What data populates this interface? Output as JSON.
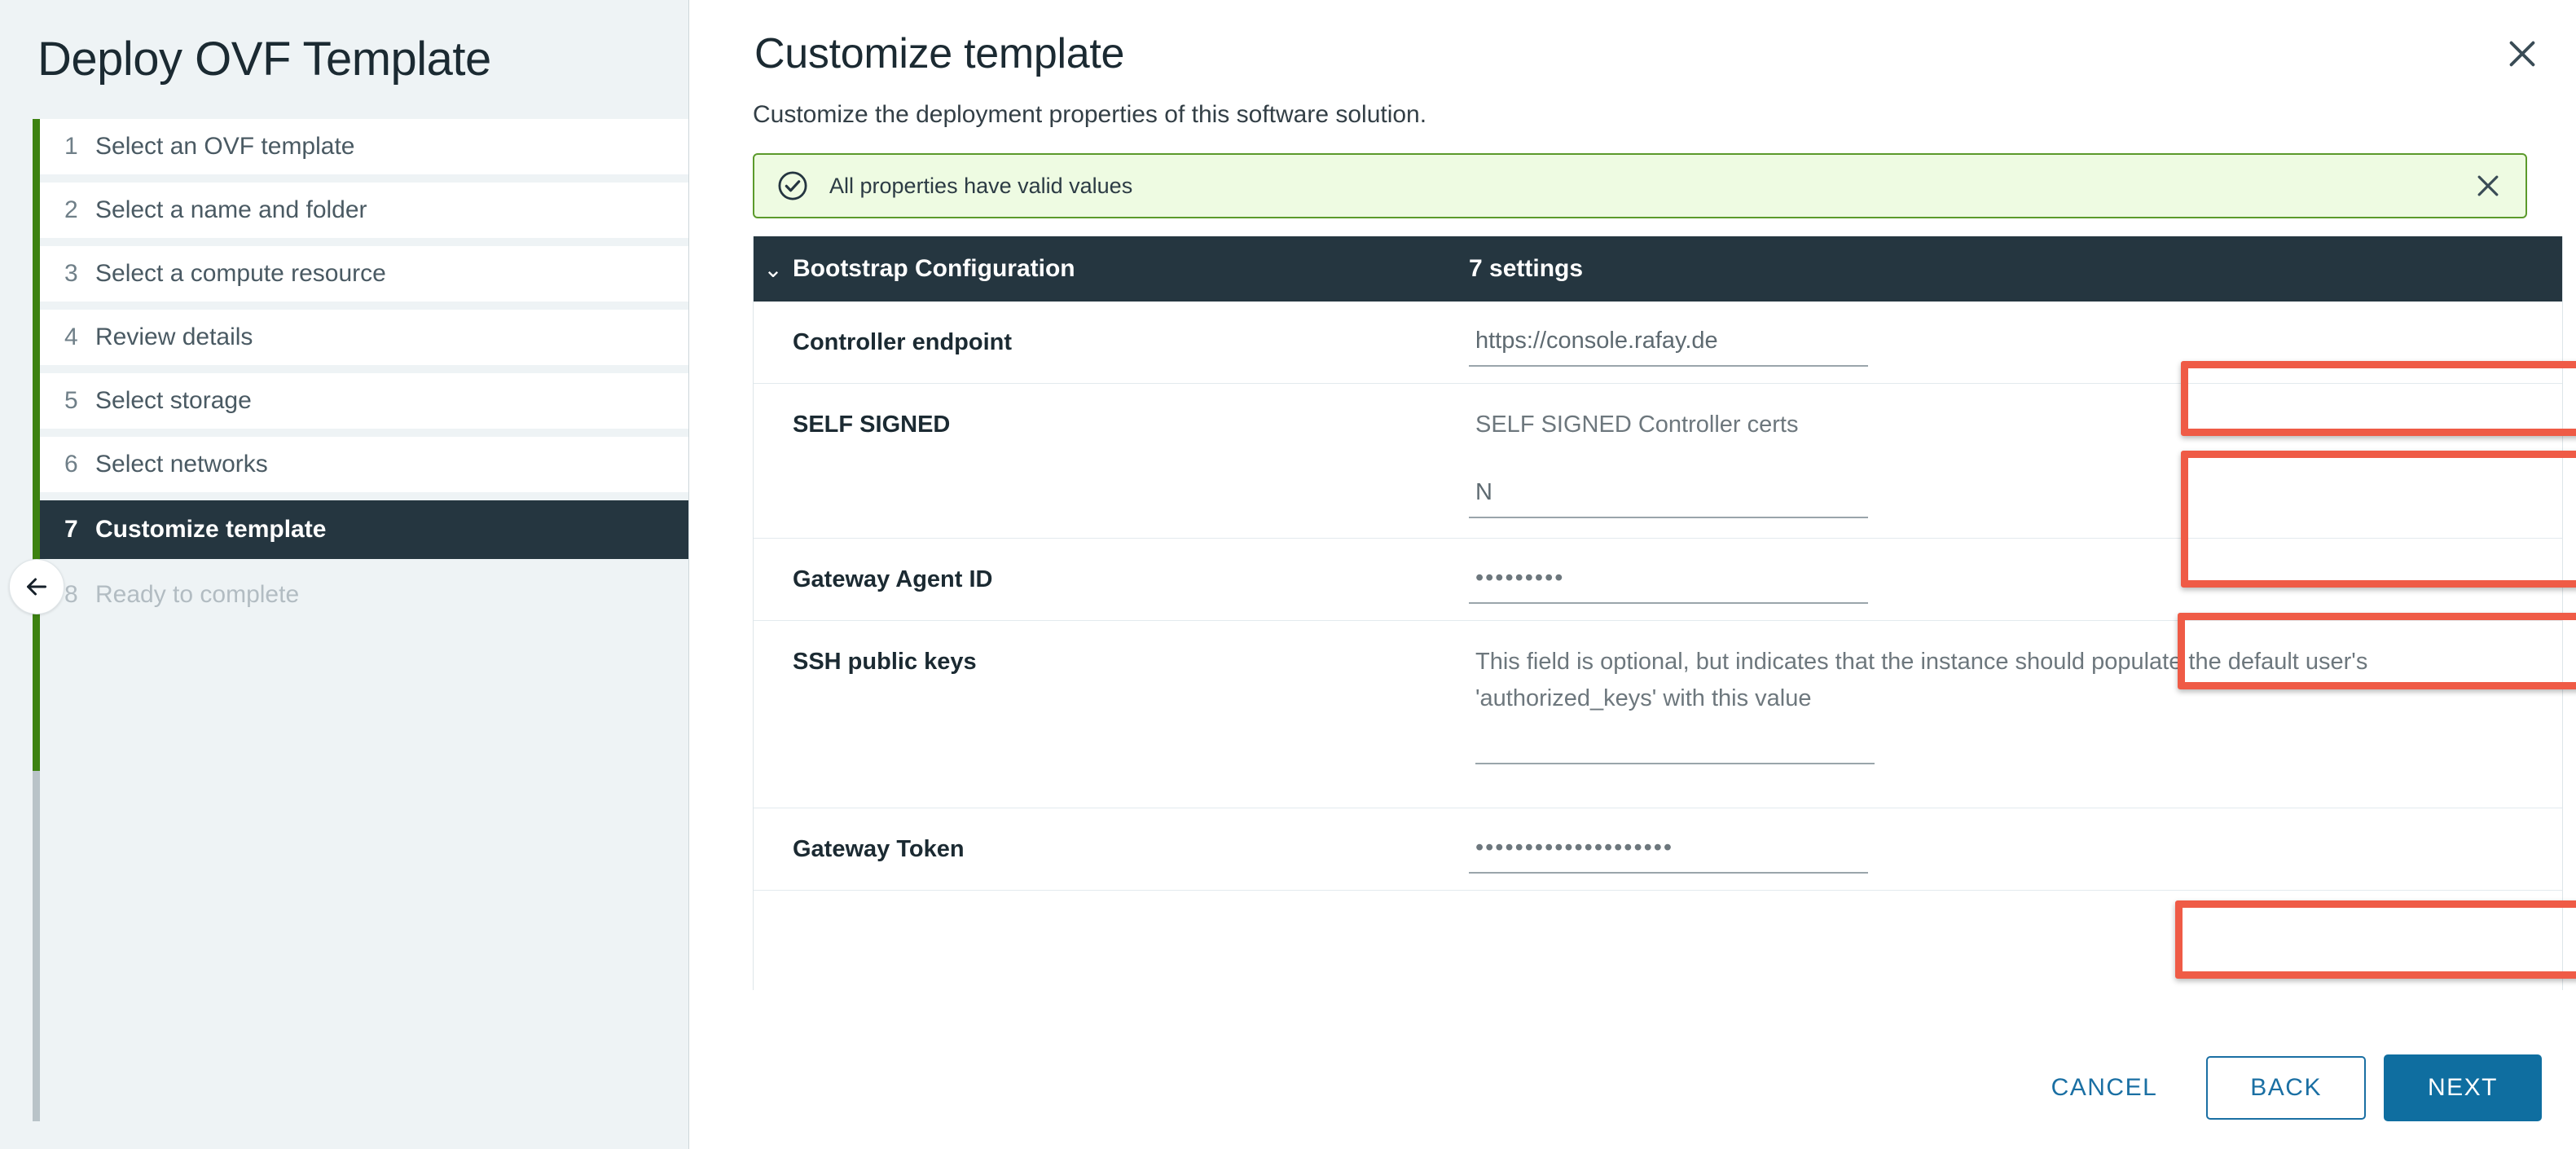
{
  "wizard": {
    "title": "Deploy OVF Template",
    "collapse_icon": "arrow-left-icon",
    "steps": [
      {
        "num": "1",
        "label": "Select an OVF template",
        "state": "done"
      },
      {
        "num": "2",
        "label": "Select a name and folder",
        "state": "done"
      },
      {
        "num": "3",
        "label": "Select a compute resource",
        "state": "done"
      },
      {
        "num": "4",
        "label": "Review details",
        "state": "done"
      },
      {
        "num": "5",
        "label": "Select storage",
        "state": "done"
      },
      {
        "num": "6",
        "label": "Select networks",
        "state": "done"
      },
      {
        "num": "7",
        "label": "Customize template",
        "state": "active"
      },
      {
        "num": "8",
        "label": "Ready to complete",
        "state": "disabled"
      }
    ]
  },
  "main": {
    "close_icon": "close-icon",
    "title": "Customize template",
    "subtitle": "Customize the deployment properties of this software solution.",
    "alert": {
      "icon": "check-circle-icon",
      "message": "All properties have valid values",
      "close_icon": "close-icon",
      "border_color": "#5b9a2b",
      "background_color": "#eefbe2"
    },
    "section": {
      "chevron": "chevron-down-icon",
      "title": "Bootstrap Configuration",
      "count": "7 settings",
      "background_color": "#253640"
    },
    "properties": [
      {
        "label": "Controller endpoint",
        "kind": "text",
        "value": "https://console.rafay.de",
        "highlighted": true
      },
      {
        "label": "SELF SIGNED",
        "kind": "text-with-helper",
        "helper": "SELF SIGNED Controller certs",
        "value": "N",
        "highlighted": true
      },
      {
        "label": "Gateway Agent ID",
        "kind": "password",
        "value": "•••••••••",
        "highlighted": true
      },
      {
        "label": "SSH public keys",
        "kind": "helper-only",
        "helper": "This field is optional, but indicates that the instance should populate the default user's 'authorized_keys' with this value",
        "value": "",
        "highlighted": false
      },
      {
        "label": "Gateway Token",
        "kind": "password",
        "value": "••••••••••••••••••••",
        "highlighted": true
      }
    ]
  },
  "footer": {
    "cancel_label": "CANCEL",
    "back_label": "BACK",
    "next_label": "NEXT",
    "accent_color": "#0f6ea0"
  }
}
